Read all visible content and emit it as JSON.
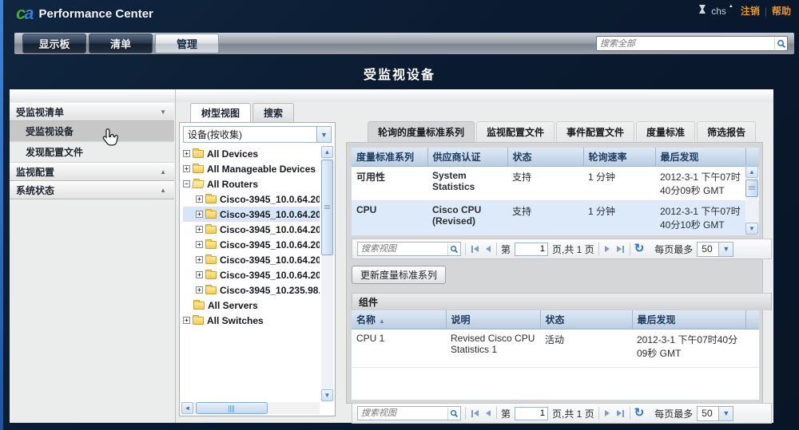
{
  "header": {
    "brand": "Performance Center",
    "user": "chs",
    "logout_label": "注销",
    "divider": "|",
    "help_label": "帮助"
  },
  "nav": {
    "tabs": [
      {
        "label": "显示板"
      },
      {
        "label": "清单"
      },
      {
        "label": "管理"
      }
    ],
    "search_placeholder": "搜索全部"
  },
  "page_title": "受监视设备",
  "sidebar": {
    "items": [
      {
        "label": "受监视清单"
      },
      {
        "label": "受监视设备"
      },
      {
        "label": "发现配置文件"
      },
      {
        "label": "监视配置"
      },
      {
        "label": "系统状态"
      }
    ]
  },
  "tree": {
    "tabs": [
      {
        "label": "树型视图"
      },
      {
        "label": "搜索"
      }
    ],
    "collection_select_value": "设备(按收集)",
    "nodes": [
      {
        "label": "All Devices"
      },
      {
        "label": "All Manageable Devices"
      },
      {
        "label": "All Routers"
      },
      {
        "label": "Cisco-3945_10.0.64.20"
      },
      {
        "label": "Cisco-3945_10.0.64.20"
      },
      {
        "label": "Cisco-3945_10.0.64.20"
      },
      {
        "label": "Cisco-3945_10.0.64.20"
      },
      {
        "label": "Cisco-3945_10.0.64.20"
      },
      {
        "label": "Cisco-3945_10.0.64.20"
      },
      {
        "label": "Cisco-3945_10.235.98."
      },
      {
        "label": "All Servers"
      },
      {
        "label": "All Switches"
      }
    ]
  },
  "right_panel": {
    "tabs": [
      {
        "label": "轮询的度量标准系列"
      },
      {
        "label": "监视配置文件"
      },
      {
        "label": "事件配置文件"
      },
      {
        "label": "度量标准"
      },
      {
        "label": "筛选报告"
      }
    ],
    "metric_table": {
      "headers": [
        "度量标准系列",
        "供应商认证",
        "状态",
        "轮询速率",
        "最后发现"
      ],
      "rows": [
        {
          "series": "可用性",
          "vendor_cert": "System Statistics",
          "status": "支持",
          "poll_rate": "1 分钟",
          "last_found": "2012-3-1 下午07时40分09秒 GMT"
        },
        {
          "series": "CPU",
          "vendor_cert": "Cisco CPU (Revised)",
          "status": "支持",
          "poll_rate": "1 分钟",
          "last_found": "2012-3-1 下午07时40分10秒 GMT"
        }
      ]
    },
    "update_button": "更新度量标准系列",
    "components_title": "组件",
    "component_table": {
      "headers": [
        "名称",
        "说明",
        "状态",
        "最后发现"
      ],
      "rows": [
        {
          "name": "CPU 1",
          "description": "Revised Cisco CPU Statistics 1",
          "status": "活动",
          "last_found": "2012-3-1 下午07时40分09秒 GMT"
        }
      ]
    },
    "pager": {
      "search_placeholder": "搜索视图",
      "page_prefix": "第",
      "page_value": "1",
      "page_suffix": "页,共 1 页",
      "per_page_label": "每页最多",
      "per_page_value": "50"
    }
  }
}
